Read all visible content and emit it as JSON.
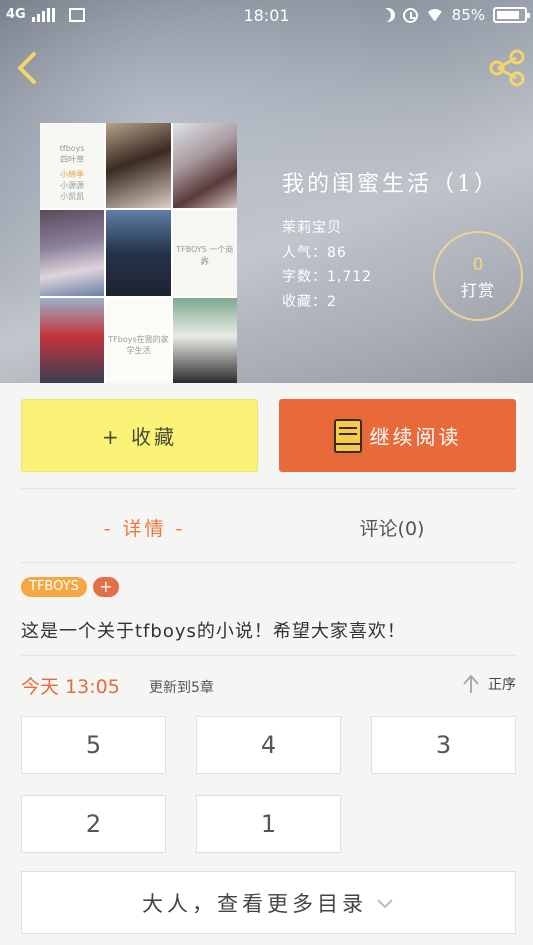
{
  "status_bar": {
    "network": "4G",
    "time": "18:01",
    "battery_text": "85%",
    "battery_level": 0.85
  },
  "header": {
    "back_icon": "chevron-left-icon",
    "share_icon": "share-icon"
  },
  "cover": {
    "texts": {
      "c1_line1": "tfboys",
      "c1_line2": "四叶草",
      "c1_line3": "小绵季",
      "c1_line4": "小源源",
      "c1_line5": "小凯凯",
      "c6_line1": "TFBOYS 一个商人",
      "c6_line2": "好",
      "c8_line1": "TFboys在我的家",
      "c8_line2": "学生活"
    }
  },
  "book": {
    "title": "我的闺蜜生活（1）",
    "author": "茉莉宝贝",
    "popularity": "人气：86",
    "word_count": "字数：1,712",
    "favorites": "收藏：2"
  },
  "tip": {
    "count": "0",
    "label": "打赏"
  },
  "actions": {
    "favorite_label": "+ 收藏",
    "read_label": "继续阅读"
  },
  "tabs": {
    "details": "- 详情 -",
    "comments": "评论(0)"
  },
  "tags": [
    "TFBOYS"
  ],
  "tag_add": "+",
  "intro": "这是一个关于tfboys的小说！希望大家喜欢！",
  "update": {
    "date": "今天  13:05",
    "note": "更新到5章",
    "sort_label": "正序"
  },
  "chapters": [
    "5",
    "4",
    "3",
    "2",
    "1"
  ],
  "more_label": "大人，查看更多目录",
  "colors": {
    "accent_orange": "#e8693a",
    "favorite_yellow": "#fbf377",
    "tag_orange": "#f5a741",
    "tip_gold": "#f4d77e"
  }
}
